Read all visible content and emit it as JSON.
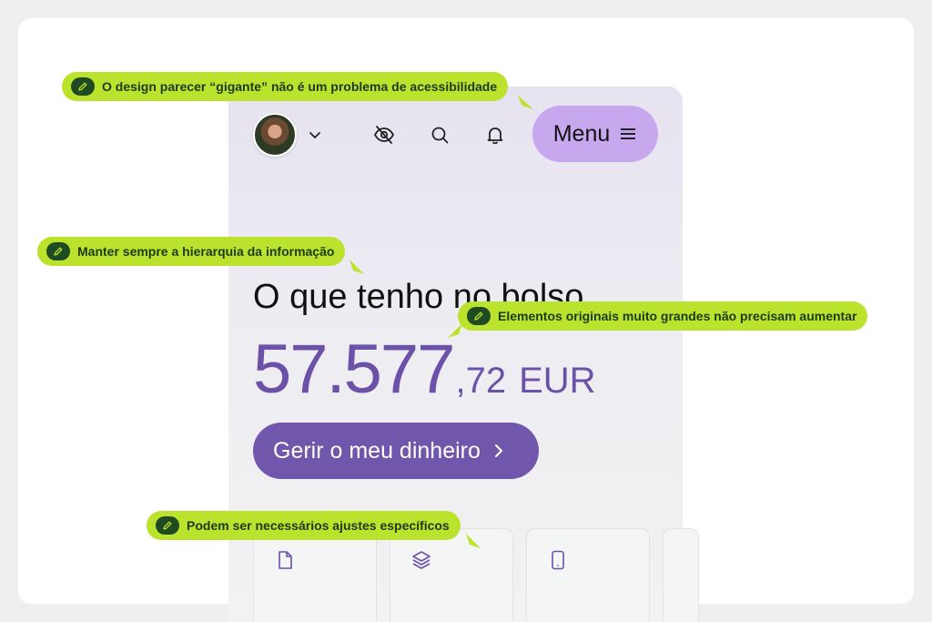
{
  "header": {
    "menu_label": "Menu",
    "icons": [
      "avatar",
      "chevron-down-icon",
      "eye-off-icon",
      "search-icon",
      "bell-icon",
      "menu-lines-icon"
    ]
  },
  "balance": {
    "heading": "O que tenho no bolso",
    "integer": "57.577",
    "decimal": ",72",
    "currency": "EUR"
  },
  "cta": {
    "label": "Gerir o meu dinheiro"
  },
  "cards": [
    {
      "icon": "document-icon"
    },
    {
      "icon": "layers-icon"
    },
    {
      "icon": "phone-icon"
    }
  ],
  "annotations": [
    {
      "text": "O design parecer “gigante” não é um problema de acessibilidade"
    },
    {
      "text": "Manter sempre a hierarquia da informação"
    },
    {
      "text": "Elementos originais muito grandes não precisam aumentar"
    },
    {
      "text": "Podem ser necessários ajustes específicos"
    }
  ],
  "colors": {
    "accent": "#7157ab",
    "amount": "#6b52a8",
    "menu_button": "#c7a8ef",
    "annotation": "#bbe22c",
    "annotation_icon": "#1f4b22"
  }
}
